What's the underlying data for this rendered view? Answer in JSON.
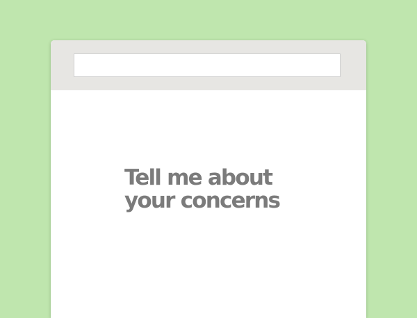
{
  "page": {
    "background_color": "#bfe6ae"
  },
  "toolbar": {
    "background_color": "#e7e6e3",
    "address_bar": {
      "value": "",
      "placeholder": ""
    }
  },
  "content": {
    "headline_lines": [
      "Tell me about",
      "your concerns"
    ],
    "headline_color": "#7b7b7b"
  }
}
